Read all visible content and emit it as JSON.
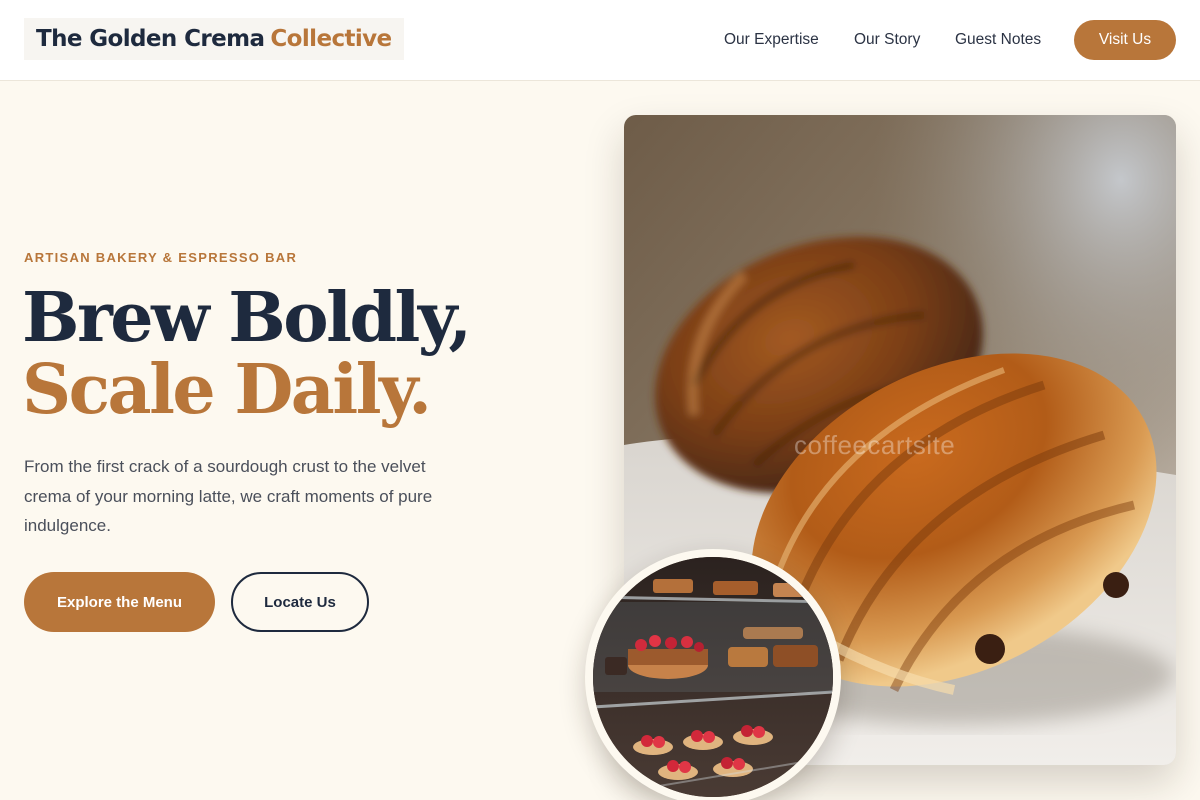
{
  "brand": {
    "name_part1": "The Golden Crema",
    "name_part2": "Collective"
  },
  "nav": {
    "items": [
      "Our Expertise",
      "Our Story",
      "Guest Notes"
    ],
    "cta_label": "Visit Us"
  },
  "hero": {
    "eyebrow": "ARTISAN BAKERY & ESPRESSO BAR",
    "headline_line1": "Brew Boldly,",
    "headline_line2": "Scale Daily.",
    "lead": "From the first crack of a sourdough crust to the velvet crema of your morning latte, we craft moments of pure indulgence.",
    "primary_button": "Explore the Menu",
    "secondary_button": "Locate Us",
    "watermark": "coffeecartsite"
  },
  "colors": {
    "accent": "#b8763a",
    "navy": "#1e2a3e",
    "background": "#fdf9f0"
  },
  "images": {
    "main": "croissant-photo",
    "inset": "pastry-display-case-photo"
  }
}
